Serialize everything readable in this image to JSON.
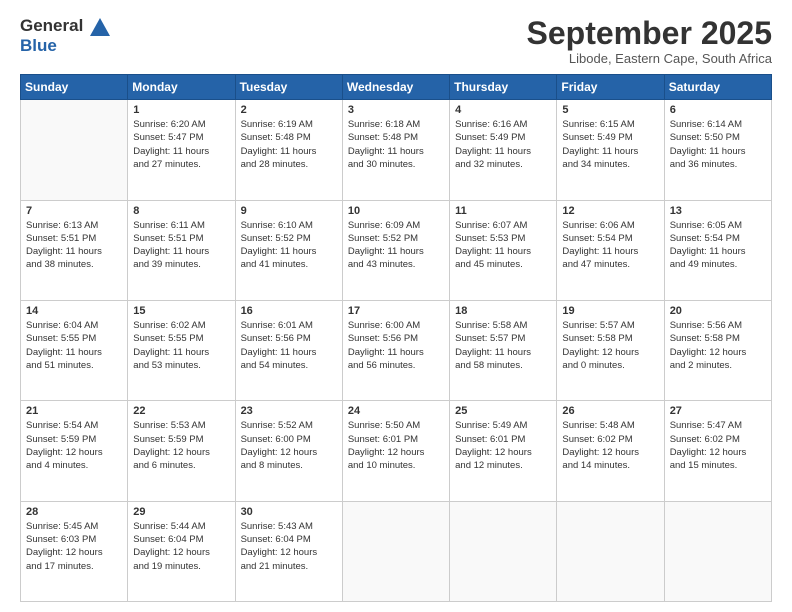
{
  "logo": {
    "line1": "General",
    "line2": "Blue"
  },
  "title": "September 2025",
  "location": "Libode, Eastern Cape, South Africa",
  "days_header": [
    "Sunday",
    "Monday",
    "Tuesday",
    "Wednesday",
    "Thursday",
    "Friday",
    "Saturday"
  ],
  "weeks": [
    [
      {
        "day": "",
        "info": ""
      },
      {
        "day": "1",
        "info": "Sunrise: 6:20 AM\nSunset: 5:47 PM\nDaylight: 11 hours\nand 27 minutes."
      },
      {
        "day": "2",
        "info": "Sunrise: 6:19 AM\nSunset: 5:48 PM\nDaylight: 11 hours\nand 28 minutes."
      },
      {
        "day": "3",
        "info": "Sunrise: 6:18 AM\nSunset: 5:48 PM\nDaylight: 11 hours\nand 30 minutes."
      },
      {
        "day": "4",
        "info": "Sunrise: 6:16 AM\nSunset: 5:49 PM\nDaylight: 11 hours\nand 32 minutes."
      },
      {
        "day": "5",
        "info": "Sunrise: 6:15 AM\nSunset: 5:49 PM\nDaylight: 11 hours\nand 34 minutes."
      },
      {
        "day": "6",
        "info": "Sunrise: 6:14 AM\nSunset: 5:50 PM\nDaylight: 11 hours\nand 36 minutes."
      }
    ],
    [
      {
        "day": "7",
        "info": "Sunrise: 6:13 AM\nSunset: 5:51 PM\nDaylight: 11 hours\nand 38 minutes."
      },
      {
        "day": "8",
        "info": "Sunrise: 6:11 AM\nSunset: 5:51 PM\nDaylight: 11 hours\nand 39 minutes."
      },
      {
        "day": "9",
        "info": "Sunrise: 6:10 AM\nSunset: 5:52 PM\nDaylight: 11 hours\nand 41 minutes."
      },
      {
        "day": "10",
        "info": "Sunrise: 6:09 AM\nSunset: 5:52 PM\nDaylight: 11 hours\nand 43 minutes."
      },
      {
        "day": "11",
        "info": "Sunrise: 6:07 AM\nSunset: 5:53 PM\nDaylight: 11 hours\nand 45 minutes."
      },
      {
        "day": "12",
        "info": "Sunrise: 6:06 AM\nSunset: 5:54 PM\nDaylight: 11 hours\nand 47 minutes."
      },
      {
        "day": "13",
        "info": "Sunrise: 6:05 AM\nSunset: 5:54 PM\nDaylight: 11 hours\nand 49 minutes."
      }
    ],
    [
      {
        "day": "14",
        "info": "Sunrise: 6:04 AM\nSunset: 5:55 PM\nDaylight: 11 hours\nand 51 minutes."
      },
      {
        "day": "15",
        "info": "Sunrise: 6:02 AM\nSunset: 5:55 PM\nDaylight: 11 hours\nand 53 minutes."
      },
      {
        "day": "16",
        "info": "Sunrise: 6:01 AM\nSunset: 5:56 PM\nDaylight: 11 hours\nand 54 minutes."
      },
      {
        "day": "17",
        "info": "Sunrise: 6:00 AM\nSunset: 5:56 PM\nDaylight: 11 hours\nand 56 minutes."
      },
      {
        "day": "18",
        "info": "Sunrise: 5:58 AM\nSunset: 5:57 PM\nDaylight: 11 hours\nand 58 minutes."
      },
      {
        "day": "19",
        "info": "Sunrise: 5:57 AM\nSunset: 5:58 PM\nDaylight: 12 hours\nand 0 minutes."
      },
      {
        "day": "20",
        "info": "Sunrise: 5:56 AM\nSunset: 5:58 PM\nDaylight: 12 hours\nand 2 minutes."
      }
    ],
    [
      {
        "day": "21",
        "info": "Sunrise: 5:54 AM\nSunset: 5:59 PM\nDaylight: 12 hours\nand 4 minutes."
      },
      {
        "day": "22",
        "info": "Sunrise: 5:53 AM\nSunset: 5:59 PM\nDaylight: 12 hours\nand 6 minutes."
      },
      {
        "day": "23",
        "info": "Sunrise: 5:52 AM\nSunset: 6:00 PM\nDaylight: 12 hours\nand 8 minutes."
      },
      {
        "day": "24",
        "info": "Sunrise: 5:50 AM\nSunset: 6:01 PM\nDaylight: 12 hours\nand 10 minutes."
      },
      {
        "day": "25",
        "info": "Sunrise: 5:49 AM\nSunset: 6:01 PM\nDaylight: 12 hours\nand 12 minutes."
      },
      {
        "day": "26",
        "info": "Sunrise: 5:48 AM\nSunset: 6:02 PM\nDaylight: 12 hours\nand 14 minutes."
      },
      {
        "day": "27",
        "info": "Sunrise: 5:47 AM\nSunset: 6:02 PM\nDaylight: 12 hours\nand 15 minutes."
      }
    ],
    [
      {
        "day": "28",
        "info": "Sunrise: 5:45 AM\nSunset: 6:03 PM\nDaylight: 12 hours\nand 17 minutes."
      },
      {
        "day": "29",
        "info": "Sunrise: 5:44 AM\nSunset: 6:04 PM\nDaylight: 12 hours\nand 19 minutes."
      },
      {
        "day": "30",
        "info": "Sunrise: 5:43 AM\nSunset: 6:04 PM\nDaylight: 12 hours\nand 21 minutes."
      },
      {
        "day": "",
        "info": ""
      },
      {
        "day": "",
        "info": ""
      },
      {
        "day": "",
        "info": ""
      },
      {
        "day": "",
        "info": ""
      }
    ]
  ]
}
